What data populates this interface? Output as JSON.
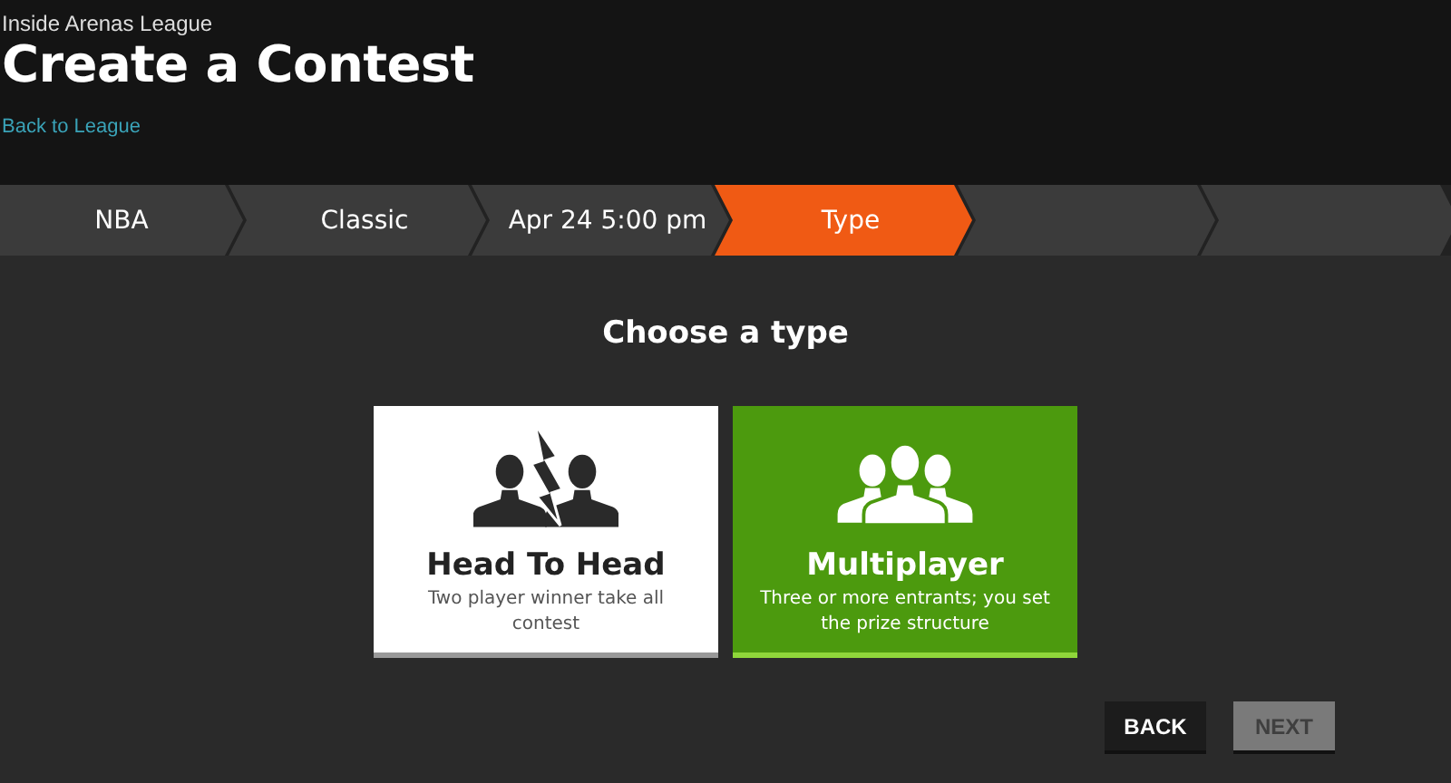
{
  "header": {
    "league": "Inside Arenas League",
    "title": "Create a Contest",
    "back_link": "Back to League"
  },
  "steps": [
    {
      "label": "NBA",
      "selected": false
    },
    {
      "label": "Classic",
      "selected": false
    },
    {
      "label": "Apr 24 5:00 pm",
      "selected": false
    },
    {
      "label": "Type",
      "selected": true
    }
  ],
  "heading": "Choose a type",
  "types": [
    {
      "kind": "head-to-head",
      "title": "Head To Head",
      "description": "Two player winner take all contest",
      "selected": false
    },
    {
      "kind": "multiplayer",
      "title": "Multiplayer",
      "description": "Three or more entrants; you set the prize structure",
      "selected": true
    }
  ],
  "buttons": [
    {
      "label": "BACK",
      "disabled": false
    },
    {
      "label": "NEXT",
      "disabled": true
    }
  ]
}
